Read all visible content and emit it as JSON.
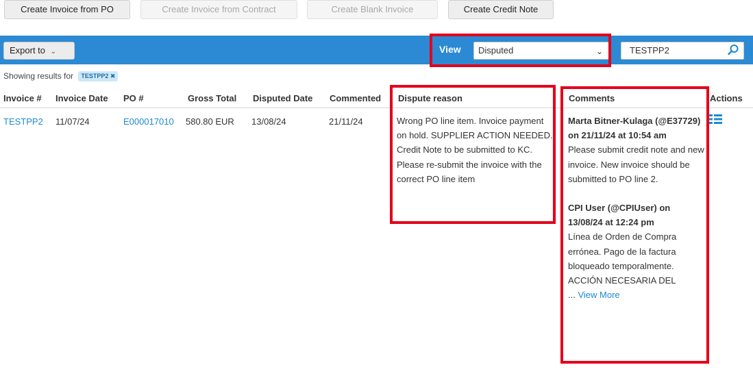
{
  "top_buttons": {
    "create_from_po": "Create Invoice from PO",
    "create_from_contract": "Create Invoice from Contract",
    "create_blank": "Create Blank Invoice",
    "create_credit_note": "Create Credit Note"
  },
  "toolbar": {
    "export_label": "Export to",
    "view_label": "View",
    "view_selected": "Disputed",
    "search_value": "TESTPP2"
  },
  "filter": {
    "showing_text": "Showing results for",
    "chip_text": "TESTPP2 ✖"
  },
  "table": {
    "headers": {
      "invoice_no": "Invoice #",
      "invoice_date": "Invoice Date",
      "po_no": "PO #",
      "gross_total": "Gross Total",
      "disputed_date": "Disputed Date",
      "commented": "Commented",
      "dispute_reason": "Dispute reason",
      "comments": "Comments",
      "actions": "Actions"
    },
    "rows": [
      {
        "invoice_no": "TESTPP2",
        "invoice_date": "11/07/24",
        "po_no": "E000017010",
        "gross_total": "580.80 EUR",
        "disputed_date": "13/08/24",
        "commented": "21/11/24",
        "dispute_reason": "Wrong PO line item. Invoice payment on hold. SUPPLIER ACTION NEEDED. Credit Note to be submitted to KC. Please re-submit the invoice with the correct PO line item",
        "comments": {
          "c1_author": "Marta Bitner-Kulaga (@E37729) on 21/11/24 at 10:54 am",
          "c1_text": "Please submit credit note and new invoice. New invoice should be submitted to PO line 2.",
          "c2_author": "CPI User (@CPIUser) on 13/08/24 at 12:24 pm",
          "c2_text": "Línea de Orden de Compra errónea. Pago de la factura bloqueado temporalmente. ACCIÓN NECESARIA DEL",
          "ellipsis": "...",
          "view_more": "View More"
        }
      }
    ]
  },
  "colors": {
    "toolbar_blue": "#2b8ad3",
    "link_blue": "#1a8ad0",
    "highlight_red": "#e3001b"
  },
  "icons": {
    "search": "search-icon",
    "chevron": "chevron-down-icon",
    "actions": "actions-menu-icon"
  }
}
